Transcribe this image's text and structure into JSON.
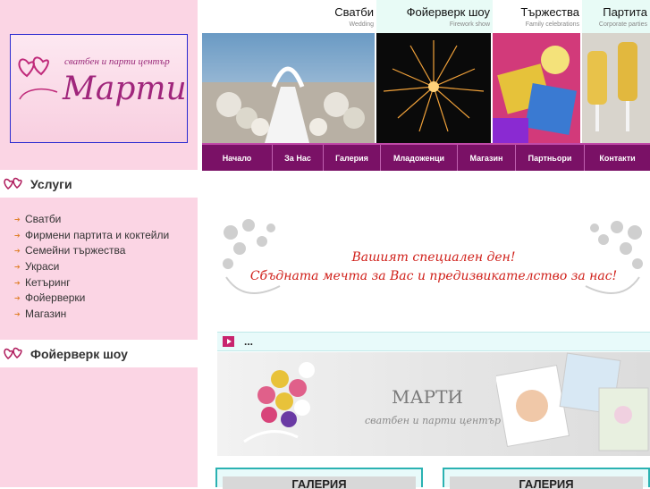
{
  "logo": {
    "small_text": "сватбен и парти център",
    "big_text": "Марти"
  },
  "left": {
    "services_title": "Услуги",
    "services": [
      "Сватби",
      "Фирмени партита и коктейли",
      "Семейни тържества",
      "Украси",
      "Кетъринг",
      "Фойерверки",
      "Магазин"
    ],
    "fireworks_title": "Фойерверк шоу"
  },
  "topnav": [
    {
      "title": "Сватби",
      "subtitle": "Wedding"
    },
    {
      "title": "Фойерверк шоу",
      "subtitle": "Firework show"
    },
    {
      "title": "Тържества",
      "subtitle": "Family celebrations"
    },
    {
      "title": "Партита",
      "subtitle": "Corporate parties"
    }
  ],
  "menu": [
    "Начало",
    "За Нас",
    "Галерия",
    "Младоженци",
    "Магазин",
    "Партньори",
    "Контакти"
  ],
  "banner": {
    "line1": "Вашият специален ден!",
    "line2": "Сбъдната мечта за Вас и предизвикателство за нас!"
  },
  "news": {
    "text": "..."
  },
  "promo": {
    "title": "МАРТИ",
    "subtitle": "сватбен и парти център"
  },
  "gallery": [
    "ГАЛЕРИЯ",
    "ГАЛЕРИЯ"
  ],
  "colors": {
    "left_bg": "#fbd5e4",
    "menu_bg": "#7a1166",
    "tagline": "#d0201a",
    "logo_text": "#a0267c",
    "teal_border": "#2ab2b2"
  }
}
